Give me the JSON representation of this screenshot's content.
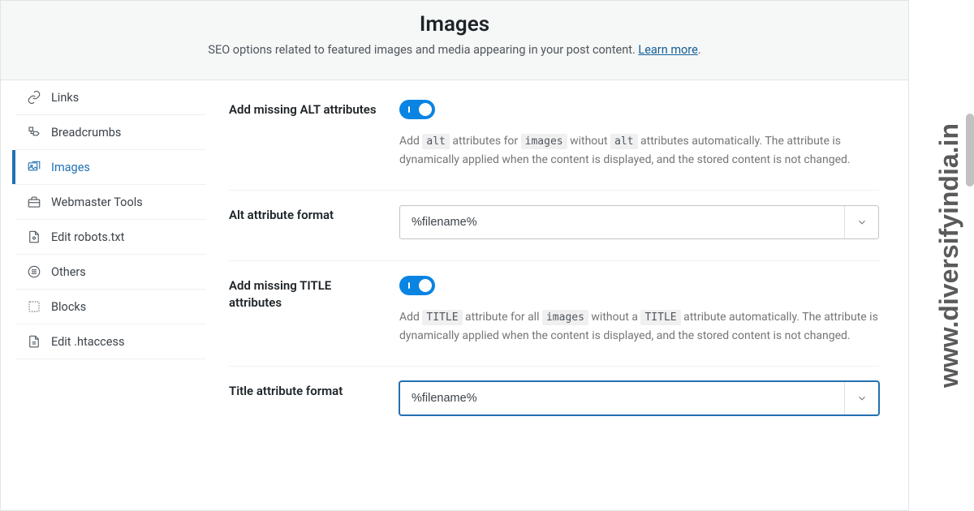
{
  "header": {
    "title": "Images",
    "subtitle_prefix": "SEO options related to featured images and media appearing in your post content. ",
    "learn_more": "Learn more",
    "subtitle_suffix": "."
  },
  "sidebar": {
    "items": [
      {
        "label": "Links"
      },
      {
        "label": "Breadcrumbs"
      },
      {
        "label": "Images"
      },
      {
        "label": "Webmaster Tools"
      },
      {
        "label": "Edit robots.txt"
      },
      {
        "label": "Others"
      },
      {
        "label": "Blocks"
      },
      {
        "label": "Edit .htaccess"
      }
    ]
  },
  "settings": {
    "alt_toggle_label": "Add missing ALT attributes",
    "alt_help_1": "Add ",
    "alt_code_1": "alt",
    "alt_help_2": " attributes for ",
    "alt_code_2": "images",
    "alt_help_3": " without ",
    "alt_code_3": "alt",
    "alt_help_4": " attributes automatically. The attribute is dynamically applied when the content is displayed, and the stored content is not changed.",
    "alt_format_label": "Alt attribute format",
    "alt_format_value": "%filename%",
    "title_toggle_label": "Add missing TITLE attributes",
    "title_help_1": "Add ",
    "title_code_1": "TITLE",
    "title_help_2": " attribute for all ",
    "title_code_2": "images",
    "title_help_3": " without a ",
    "title_code_3": "TITLE",
    "title_help_4": " attribute automatically. The attribute is dynamically applied when the content is displayed, and the stored content is not changed.",
    "title_format_label": "Title attribute format",
    "title_format_value": "%filename%"
  },
  "watermark": "www.diversifyindia.in"
}
